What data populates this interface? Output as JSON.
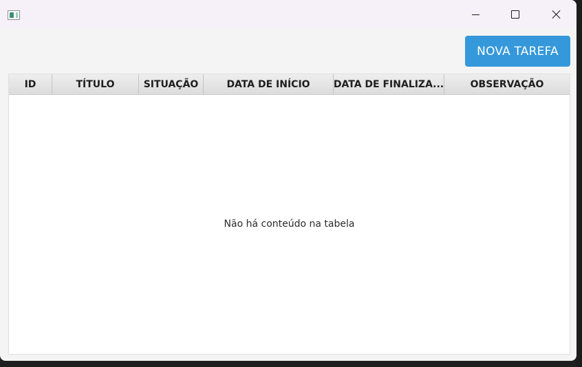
{
  "window": {
    "app_icon": "app-window-icon",
    "controls": {
      "minimize_icon": "minimize-icon",
      "maximize_icon": "maximize-icon",
      "close_icon": "close-icon"
    }
  },
  "toolbar": {
    "new_task_label": "NOVA TAREFA",
    "new_task_color": "#3498db"
  },
  "table": {
    "columns": [
      "ID",
      "TÍTULO",
      "SITUAÇÃO",
      "DATA DE INÍCIO",
      "DATA DE FINALIZA...",
      "OBSERVAÇÃO"
    ],
    "rows": [],
    "empty_message": "Não há conteúdo na tabela"
  }
}
